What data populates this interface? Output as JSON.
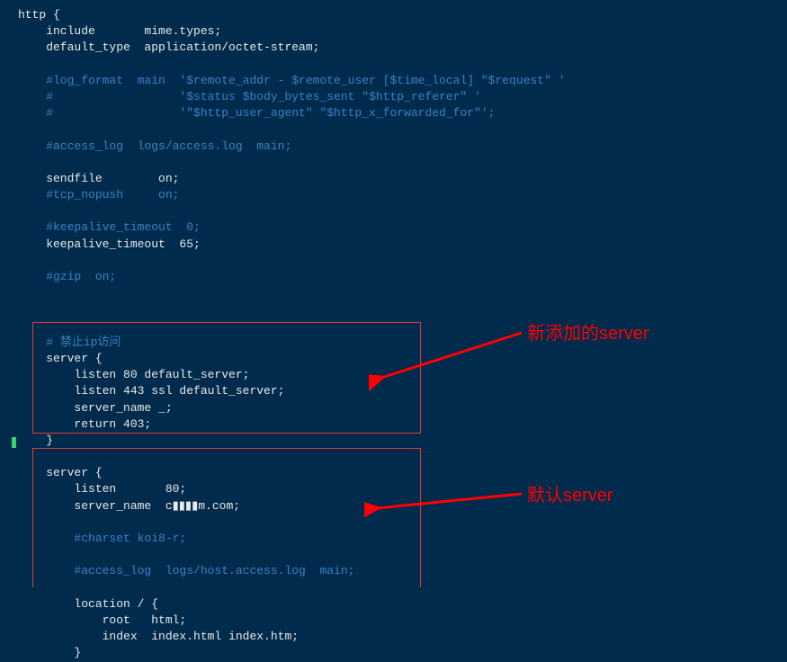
{
  "lines": [
    {
      "cls": "w",
      "text": "http {"
    },
    {
      "cls": "w",
      "text": "    include       mime.types;"
    },
    {
      "cls": "w",
      "text": "    default_type  application/octet-stream;"
    },
    {
      "cls": "w",
      "text": ""
    },
    {
      "cls": "c",
      "text": "    #log_format  main  '$remote_addr - $remote_user [$time_local] \"$request\" '"
    },
    {
      "cls": "c",
      "text": "    #                  '$status $body_bytes_sent \"$http_referer\" '"
    },
    {
      "cls": "c",
      "text": "    #                  '\"$http_user_agent\" \"$http_x_forwarded_for\"';"
    },
    {
      "cls": "w",
      "text": ""
    },
    {
      "cls": "c",
      "text": "    #access_log  logs/access.log  main;"
    },
    {
      "cls": "w",
      "text": ""
    },
    {
      "cls": "w",
      "text": "    sendfile        on;"
    },
    {
      "cls": "c",
      "text": "    #tcp_nopush     on;"
    },
    {
      "cls": "w",
      "text": ""
    },
    {
      "cls": "c",
      "text": "    #keepalive_timeout  0;"
    },
    {
      "cls": "w",
      "text": "    keepalive_timeout  65;"
    },
    {
      "cls": "w",
      "text": ""
    },
    {
      "cls": "c",
      "text": "    #gzip  on;"
    },
    {
      "cls": "w",
      "text": ""
    },
    {
      "cls": "w",
      "text": ""
    },
    {
      "cls": "w",
      "text": ""
    },
    {
      "cls": "c",
      "text": "    # 禁止ip访问"
    },
    {
      "cls": "w",
      "text": "    server {"
    },
    {
      "cls": "w",
      "text": "        listen 80 default_server;"
    },
    {
      "cls": "w",
      "text": "        listen 443 ssl default_server;"
    },
    {
      "cls": "w",
      "text": "        server_name _;"
    },
    {
      "cls": "w",
      "text": "        return 403;"
    },
    {
      "cls": "w",
      "text": "    }"
    },
    {
      "cls": "w",
      "text": ""
    },
    {
      "cls": "w",
      "text": "    server {"
    },
    {
      "cls": "w",
      "text": "        listen       80;"
    },
    {
      "cls": "w",
      "text": "        server_name  c▮▮▮▮m.com;"
    },
    {
      "cls": "w",
      "text": ""
    },
    {
      "cls": "c",
      "text": "        #charset koi8-r;"
    },
    {
      "cls": "w",
      "text": ""
    },
    {
      "cls": "c",
      "text": "        #access_log  logs/host.access.log  main;"
    },
    {
      "cls": "w",
      "text": ""
    },
    {
      "cls": "w",
      "text": "        location / {"
    },
    {
      "cls": "w",
      "text": "            root   html;"
    },
    {
      "cls": "w",
      "text": "            index  index.html index.htm;"
    },
    {
      "cls": "w",
      "text": "        }"
    }
  ],
  "annotations": {
    "new_server": "新添加的server",
    "default_server": "默认server"
  }
}
